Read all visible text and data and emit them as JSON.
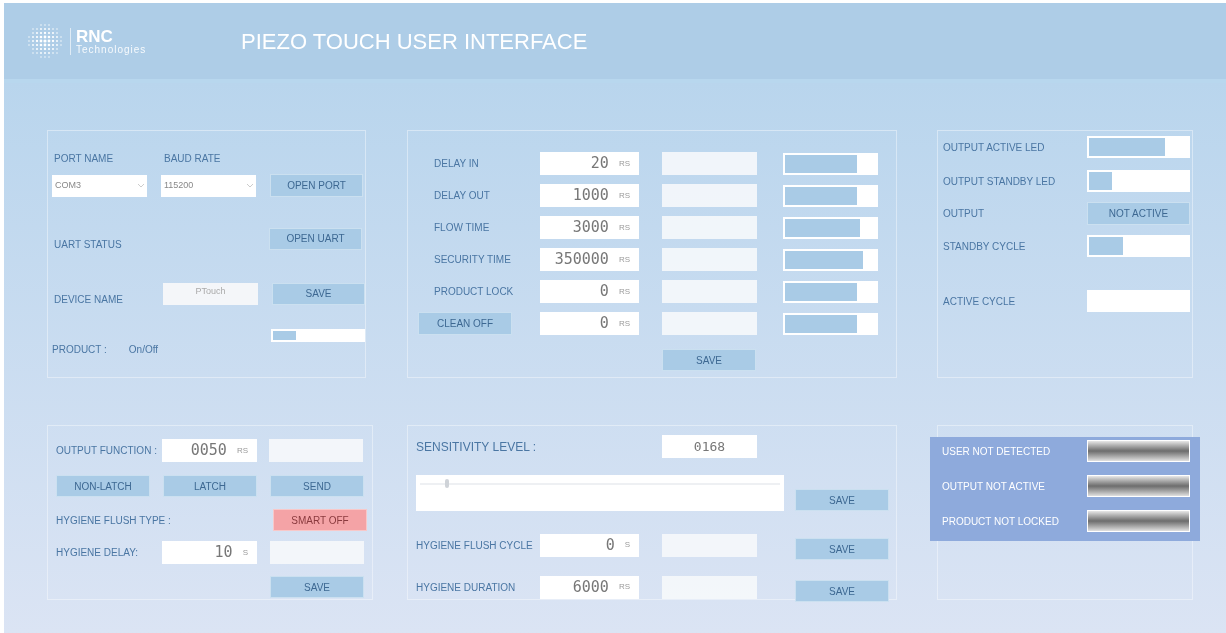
{
  "header": {
    "brand": "RNC",
    "brand_sub": "Technologies",
    "title": "PIEZO TOUCH USER INTERFACE"
  },
  "connection": {
    "port_label": "PORT NAME",
    "baud_label": "BAUD RATE",
    "port": "COM3",
    "baud": "115200",
    "open_port": "OPEN PORT",
    "uart_label": "UART STATUS",
    "open_uart": "OPEN UART",
    "device_label": "DEVICE NAME",
    "device_name": "PTouch",
    "save": "SAVE",
    "product_label": "PRODUCT :",
    "product_state": "On/Off",
    "product_toggle": {
      "level": 0.25
    }
  },
  "timings": {
    "rows": [
      {
        "kind": "label",
        "label": "DELAY IN",
        "value": "20",
        "unit": "RS",
        "level": 0.79
      },
      {
        "kind": "label",
        "label": "DELAY OUT",
        "value": "1000",
        "unit": "RS",
        "level": 0.79
      },
      {
        "kind": "label",
        "label": "FLOW TIME",
        "value": "3000",
        "unit": "RS",
        "level": 0.82
      },
      {
        "kind": "label",
        "label": "SECURITY TIME",
        "value": "350000",
        "unit": "RS",
        "level": 0.86
      },
      {
        "kind": "label",
        "label": "PRODUCT LOCK",
        "value": "0",
        "unit": "RS",
        "level": 0.79
      },
      {
        "kind": "button",
        "label": "CLEAN OFF",
        "value": "0",
        "unit": "RS",
        "level": 0.79
      }
    ],
    "save": "SAVE"
  },
  "outputs": [
    {
      "kind": "select",
      "label": "OUTPUT ACTIVE LED",
      "level": 0.77
    },
    {
      "kind": "select",
      "label": "OUTPUT STANDBY LED",
      "level": 0.23
    },
    {
      "kind": "status",
      "label": "OUTPUT",
      "value": "NOT ACTIVE"
    },
    {
      "kind": "select",
      "label": "STANDBY CYCLE",
      "level": 0.34
    },
    {
      "kind": "select",
      "label": "ACTIVE CYCLE"
    }
  ],
  "function": {
    "label": "OUTPUT FUNCTION :",
    "value": "0050",
    "unit": "RS",
    "buttons": [
      "NON-LATCH",
      "LATCH",
      "SEND"
    ],
    "flush_type_label": "HYGIENE FLUSH TYPE :",
    "flush_type": "SMART OFF",
    "delay_label": "HYGIENE DELAY:",
    "delay_value": "10",
    "delay_unit": "S",
    "save": "SAVE"
  },
  "sensitivity": {
    "label": "SENSITIVITY LEVEL :",
    "value": "0168",
    "level": 0.07,
    "save": "SAVE",
    "rows": [
      {
        "label": "HYGIENE FLUSH CYCLE",
        "value": "0",
        "unit": "S",
        "save": "SAVE"
      },
      {
        "label": "HYGIENE DURATION",
        "value": "6000",
        "unit": "RS",
        "save": "SAVE"
      }
    ]
  },
  "indicators": [
    {
      "label": "USER NOT DETECTED"
    },
    {
      "label": "OUTPUT NOT ACTIVE"
    },
    {
      "label": "PRODUCT NOT LOCKED"
    }
  ]
}
